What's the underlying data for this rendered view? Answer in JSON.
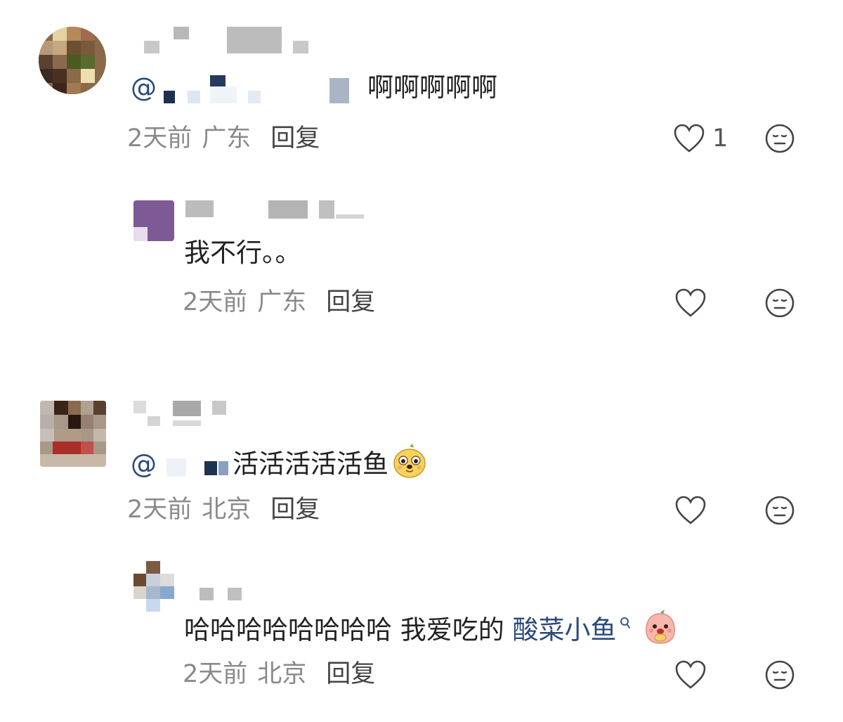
{
  "comments": [
    {
      "mention_prefix": "@",
      "text": "啊啊啊啊啊",
      "time": "2天前",
      "location": "广东",
      "reply_label": "回复",
      "like_count": "1",
      "replies": [
        {
          "text": "我不行。。",
          "time": "2天前",
          "location": "广东",
          "reply_label": "回复"
        }
      ]
    },
    {
      "mention_prefix": "@",
      "text": "活活活活活鱼",
      "emoji": "yellow-dog-sticker",
      "time": "2天前",
      "location": "北京",
      "reply_label": "回复",
      "replies": [
        {
          "text": "哈哈哈哈哈哈哈哈 我爱吃的 ",
          "link_text": "酸菜小鱼",
          "emoji": "pink-peach-sticker",
          "time": "2天前",
          "location": "北京",
          "reply_label": "回复"
        }
      ]
    }
  ],
  "icons": {
    "like": "heart-outline-icon",
    "react": "neutral-face-icon",
    "search": "search-icon"
  },
  "colors": {
    "link": "#2a4a7c",
    "meta": "#8a8a8a",
    "reply": "#444444"
  }
}
